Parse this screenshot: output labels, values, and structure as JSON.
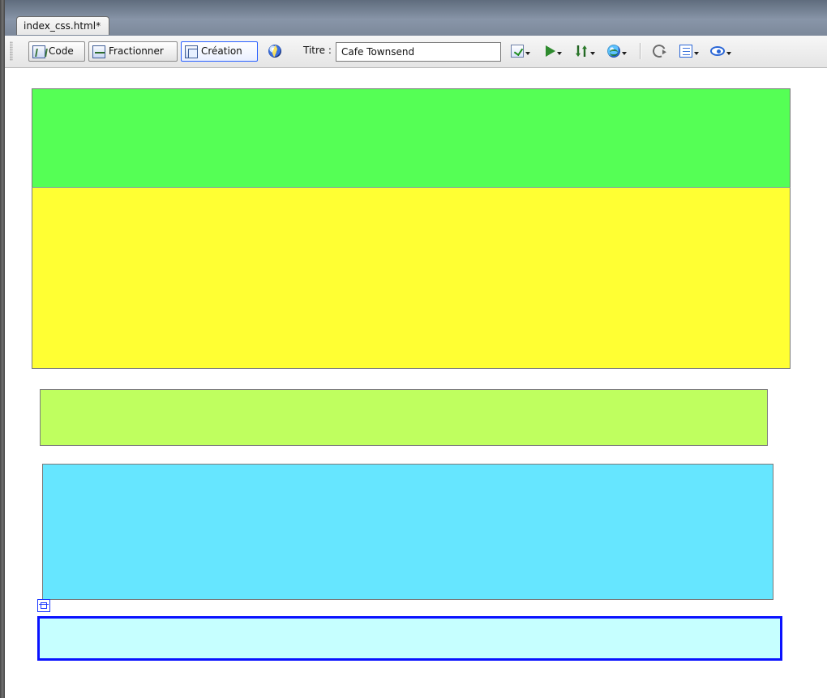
{
  "window": {
    "tab_title": "index_css.html*"
  },
  "toolbar": {
    "code_label": "Code",
    "split_label": "Fractionner",
    "design_label": "Création",
    "title_label": "Titre :",
    "title_value": "Cafe Townsend",
    "icons": {
      "code": "code-view-icon",
      "split": "split-view-icon",
      "design": "design-view-icon",
      "live": "live-view-icon",
      "validate": "validate-markup-icon",
      "preview": "preview-in-browser-icon",
      "updown": "file-management-icon",
      "globe": "browser-check-icon",
      "refresh": "refresh-icon",
      "view_options": "view-options-icon",
      "visual_aids": "visual-aids-icon"
    },
    "active_view": "Création"
  },
  "design_view": {
    "blocks": [
      {
        "name": "green-block",
        "color": "#55ff55"
      },
      {
        "name": "yellow-block",
        "color": "#ffff33"
      },
      {
        "name": "lightgreen-block",
        "color": "#bfff5f"
      },
      {
        "name": "cyan-block",
        "color": "#66e6ff"
      },
      {
        "name": "selected-block",
        "color": "#c6ffff",
        "selection_border_color": "#0a12ff"
      }
    ]
  }
}
